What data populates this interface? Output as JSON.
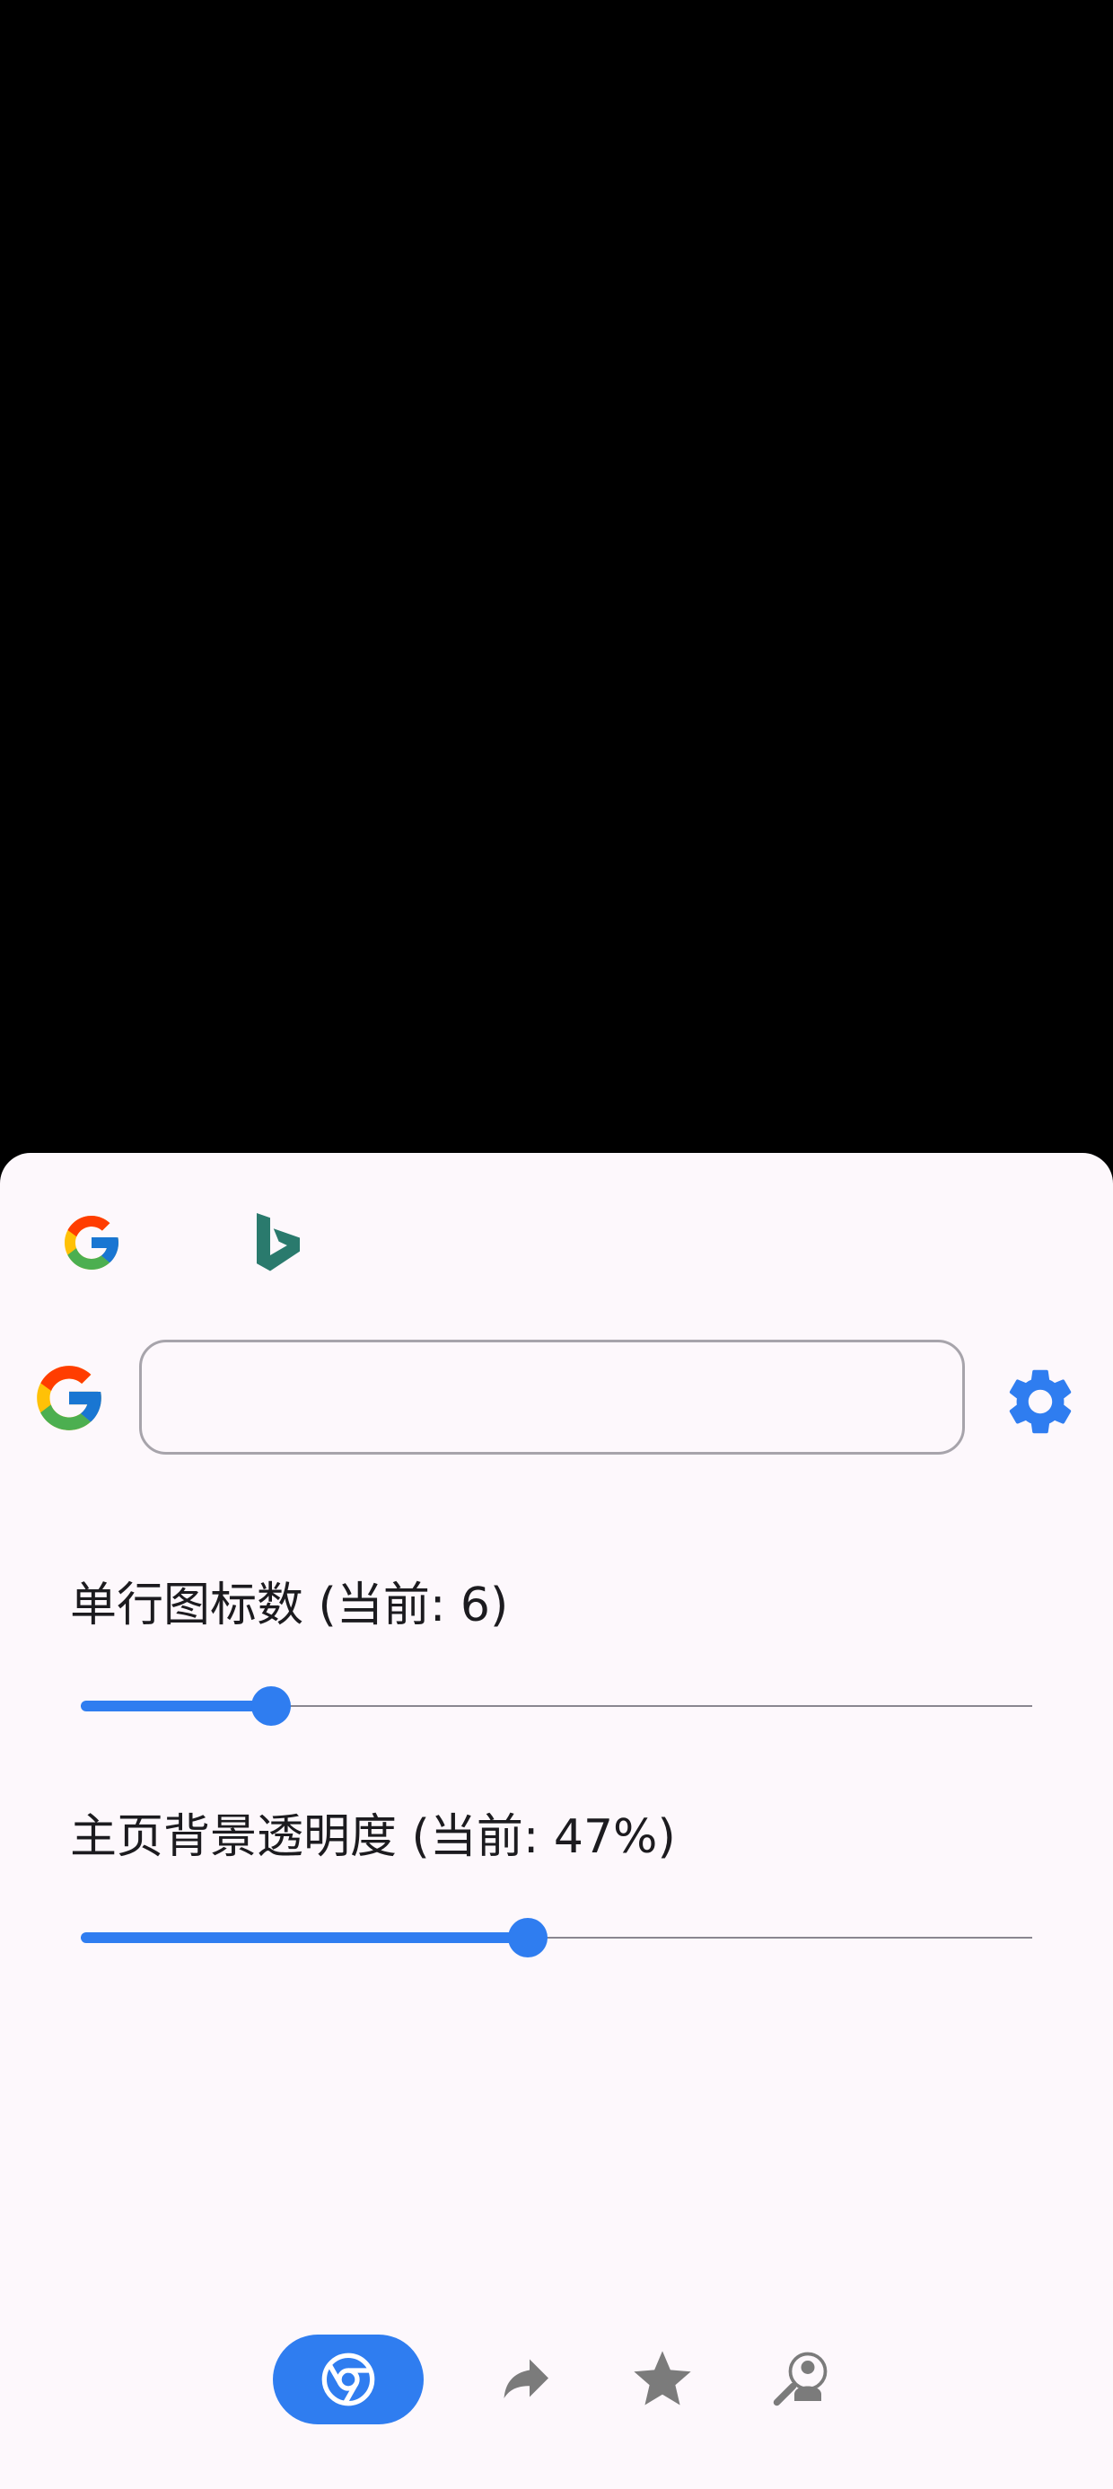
{
  "search_engines": [
    {
      "name": "google-icon",
      "selected": true
    },
    {
      "name": "bing-icon",
      "selected": false
    }
  ],
  "search": {
    "engine_icon": "google-icon",
    "value": "",
    "placeholder": "",
    "settings_icon": "gear-icon"
  },
  "settings": {
    "icons_per_row_label": "单行图标数 (当前: 6)",
    "icons_per_row_value": 6,
    "icons_per_row_fraction": 0.2,
    "opacity_label": "主页背景透明度 (当前: 47%)",
    "opacity_value": 47,
    "opacity_fraction": 0.47
  },
  "bottom_nav": {
    "items": [
      {
        "icon": "chrome-icon",
        "active": true
      },
      {
        "icon": "share-forward-icon",
        "active": false
      },
      {
        "icon": "star-icon",
        "active": false
      },
      {
        "icon": "search-person-icon",
        "active": false
      }
    ]
  },
  "colors": {
    "accent": "#2f7df0",
    "sheet_background": "#fdf8fc",
    "backdrop": "#000000",
    "icon_gray": "#7b7b7b",
    "bing_teal": "#2a7a6d"
  }
}
